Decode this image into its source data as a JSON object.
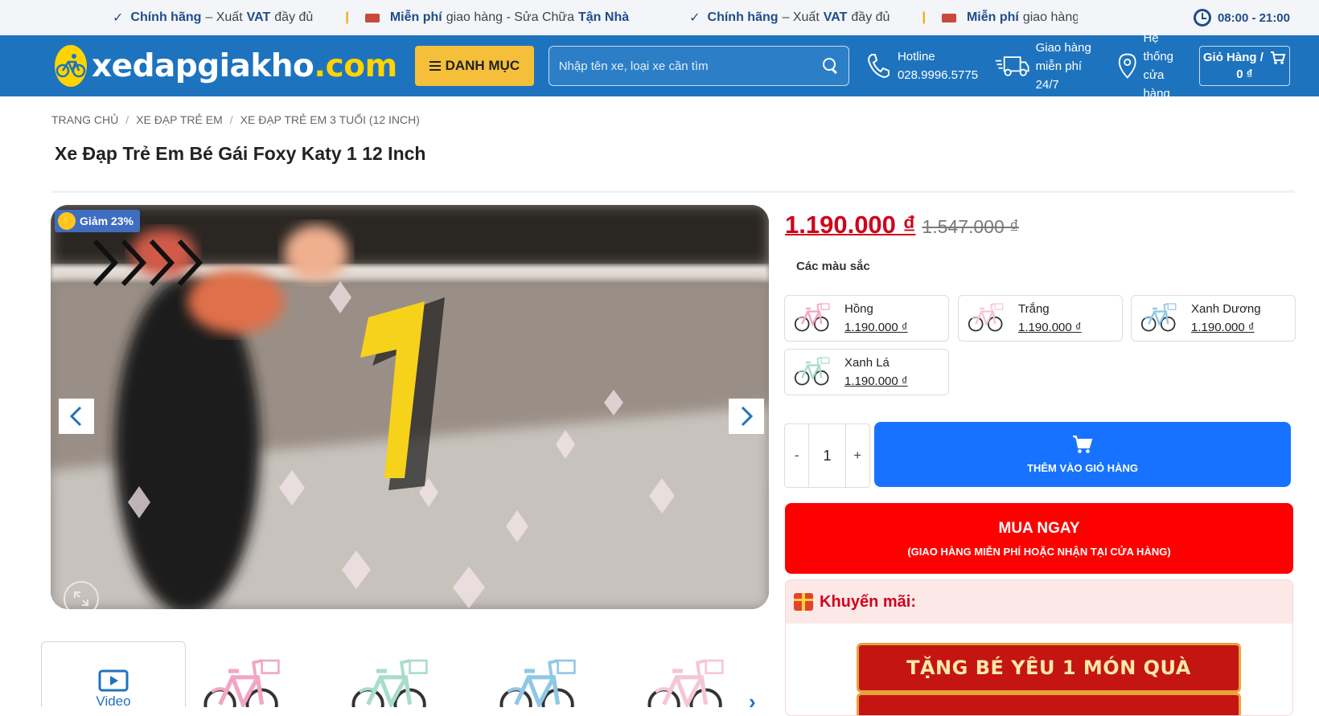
{
  "topbar": {
    "seg1": {
      "check": "✓",
      "a": "Chính hãng",
      "b": "– Xuất",
      "c": "VAT",
      "d": "đầy đủ"
    },
    "seg2": {
      "a": "Miễn phí",
      "b": "giao hàng - Sửa Chữa",
      "c": "Tận Nhà"
    },
    "seg3": {
      "check": "✓",
      "a": "Chính hãng",
      "b": "– Xuất",
      "c": "VAT",
      "d": "đầy đủ"
    },
    "seg4": {
      "a": "Miễn phí",
      "b": "giao hàng - Sửa Chữa"
    },
    "separator": "|",
    "hours": "08:00 - 21:00"
  },
  "header": {
    "logo_main": "xedapgiakho",
    "logo_tld": ".com",
    "menu_label": "DANH MỤC",
    "search_placeholder": "Nhập tên xe, loại xe cần tìm",
    "hotline_label": "Hotline",
    "hotline_number": "028.9996.5775",
    "delivery_line1": "Giao hàng",
    "delivery_line2": "miễn phí 24/7",
    "stores_line1": "Hệ thống",
    "stores_line2": "cửa hàng",
    "cart_label": "Giỏ Hàng /",
    "cart_total": "0 ₫"
  },
  "breadcrumb": [
    "TRANG CHỦ",
    "XE ĐẠP TRẺ EM",
    "XE ĐẠP TRẺ EM 3 TUỔI (12 INCH)"
  ],
  "breadcrumb_divider": "/",
  "product": {
    "title": "Xe Đạp Trẻ Em Bé Gái Foxy Katy 1 12 Inch",
    "sale_badge": "Giảm 23%",
    "price_now": "1.190.000 ₫",
    "price_old": "1.547.000 ₫",
    "colors_heading": "Các màu sắc",
    "variants": [
      {
        "name": "Hồng",
        "price": "1.190.000 ₫",
        "color": "#f2a6c4"
      },
      {
        "name": "Trắng",
        "price": "1.190.000 ₫",
        "color": "#f4c6d6"
      },
      {
        "name": "Xanh Dương",
        "price": "1.190.000 ₫",
        "color": "#8fc8e6"
      },
      {
        "name": "Xanh Lá",
        "price": "1.190.000 ₫",
        "color": "#a9dccb"
      }
    ],
    "quantity": "1",
    "qty_minus": "-",
    "qty_plus": "+",
    "add_to_cart": "THÊM VÀO GIỎ HÀNG",
    "buy_now": "MUA NGAY",
    "buy_now_sub": "(GIAO HÀNG MIỄN PHÍ HOẶC NHẬN TẠI CỬA HÀNG)",
    "promo_title": "Khuyến mãi:",
    "promo_banner": "TẶNG BÉ YÊU 1 MÓN QUÀ",
    "slide_number": "1",
    "video_label": "Video"
  },
  "colors": {
    "brand_blue": "#1e73be",
    "accent_yellow": "#f5bf3a",
    "price_red": "#d0021b",
    "cart_button": "#1773ff",
    "buy_button": "#ff0000"
  }
}
